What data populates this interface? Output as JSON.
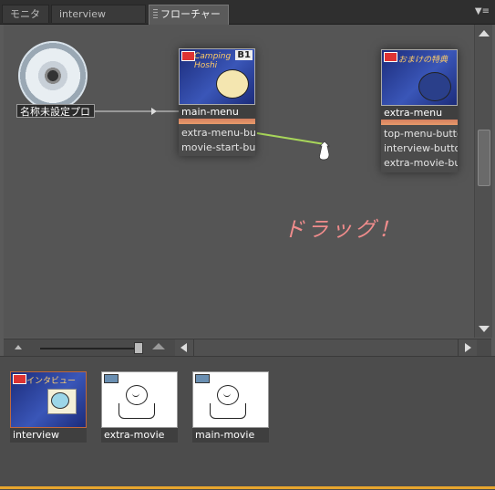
{
  "tabs": [
    {
      "label": "モニタ"
    },
    {
      "label": "interview"
    },
    {
      "label": "フローチャート",
      "close": "×"
    }
  ],
  "panel_menu": "▼≡",
  "disc": {
    "label": "名称未設定プロ"
  },
  "nodes": [
    {
      "name": "main-menu",
      "tag": "B1",
      "title": "Camping Hoshi",
      "buttons": [
        "extra-menu-button",
        "movie-start-button"
      ]
    },
    {
      "name": "extra-menu",
      "title": "おまけの特典",
      "buttons": [
        "top-menu-button",
        "interview-button",
        "extra-movie-button"
      ]
    }
  ],
  "annotation": {
    "text": "ドラッグ！"
  },
  "bin_items": [
    {
      "label": "interview",
      "title": "インタビュー"
    },
    {
      "label": "extra-movie"
    },
    {
      "label": "main-movie"
    }
  ],
  "colors": {
    "accent": "#e8a62e",
    "drag_line": "#a8d65a",
    "annotation": "#f08c8c"
  }
}
